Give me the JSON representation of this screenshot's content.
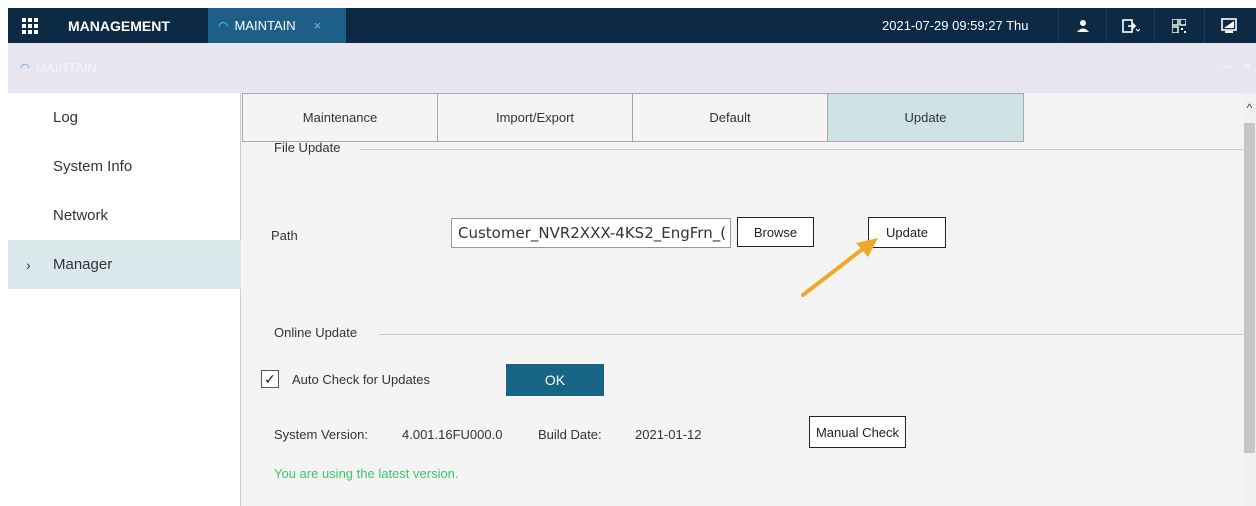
{
  "topbar": {
    "app_title": "MANAGEMENT",
    "tab_label": "MAINTAIN",
    "tab_close": "×",
    "datetime": "2021-07-29 09:59:27 Thu",
    "icons": [
      "user-icon",
      "logout-icon",
      "qr-code-icon",
      "monitor-icon"
    ]
  },
  "subheader": {
    "title": "MAINTAIN",
    "controls": "– ×"
  },
  "sidebar": {
    "items": [
      {
        "label": "Log"
      },
      {
        "label": "System Info"
      },
      {
        "label": "Network"
      },
      {
        "label": "Manager",
        "caret": "›"
      }
    ]
  },
  "tabs": [
    "Maintenance",
    "Import/Export",
    "Default",
    "Update"
  ],
  "file_update": {
    "section_title": "File Update",
    "path_label": "Path",
    "path_value": "Customer_NVR2XXX-4KS2_EngFrn_(",
    "browse_label": "Browse",
    "update_label": "Update"
  },
  "online_update": {
    "section_title": "Online Update",
    "auto_check_label": "Auto Check for Updates",
    "checkbox_mark": "✓",
    "ok_label": "OK",
    "system_version_label": "System Version:",
    "system_version_value": "4.001.16FU000.0",
    "build_date_label": "Build Date:",
    "build_date_value": "2021-01-12",
    "manual_check_label": "Manual Check",
    "status": "You are using the latest version."
  },
  "colors": {
    "topbar": "#0d2a44",
    "tab_active": "#1d5f87",
    "ok_button": "#176484",
    "status_green": "#3bc96a",
    "arrow": "#f0a82b"
  }
}
